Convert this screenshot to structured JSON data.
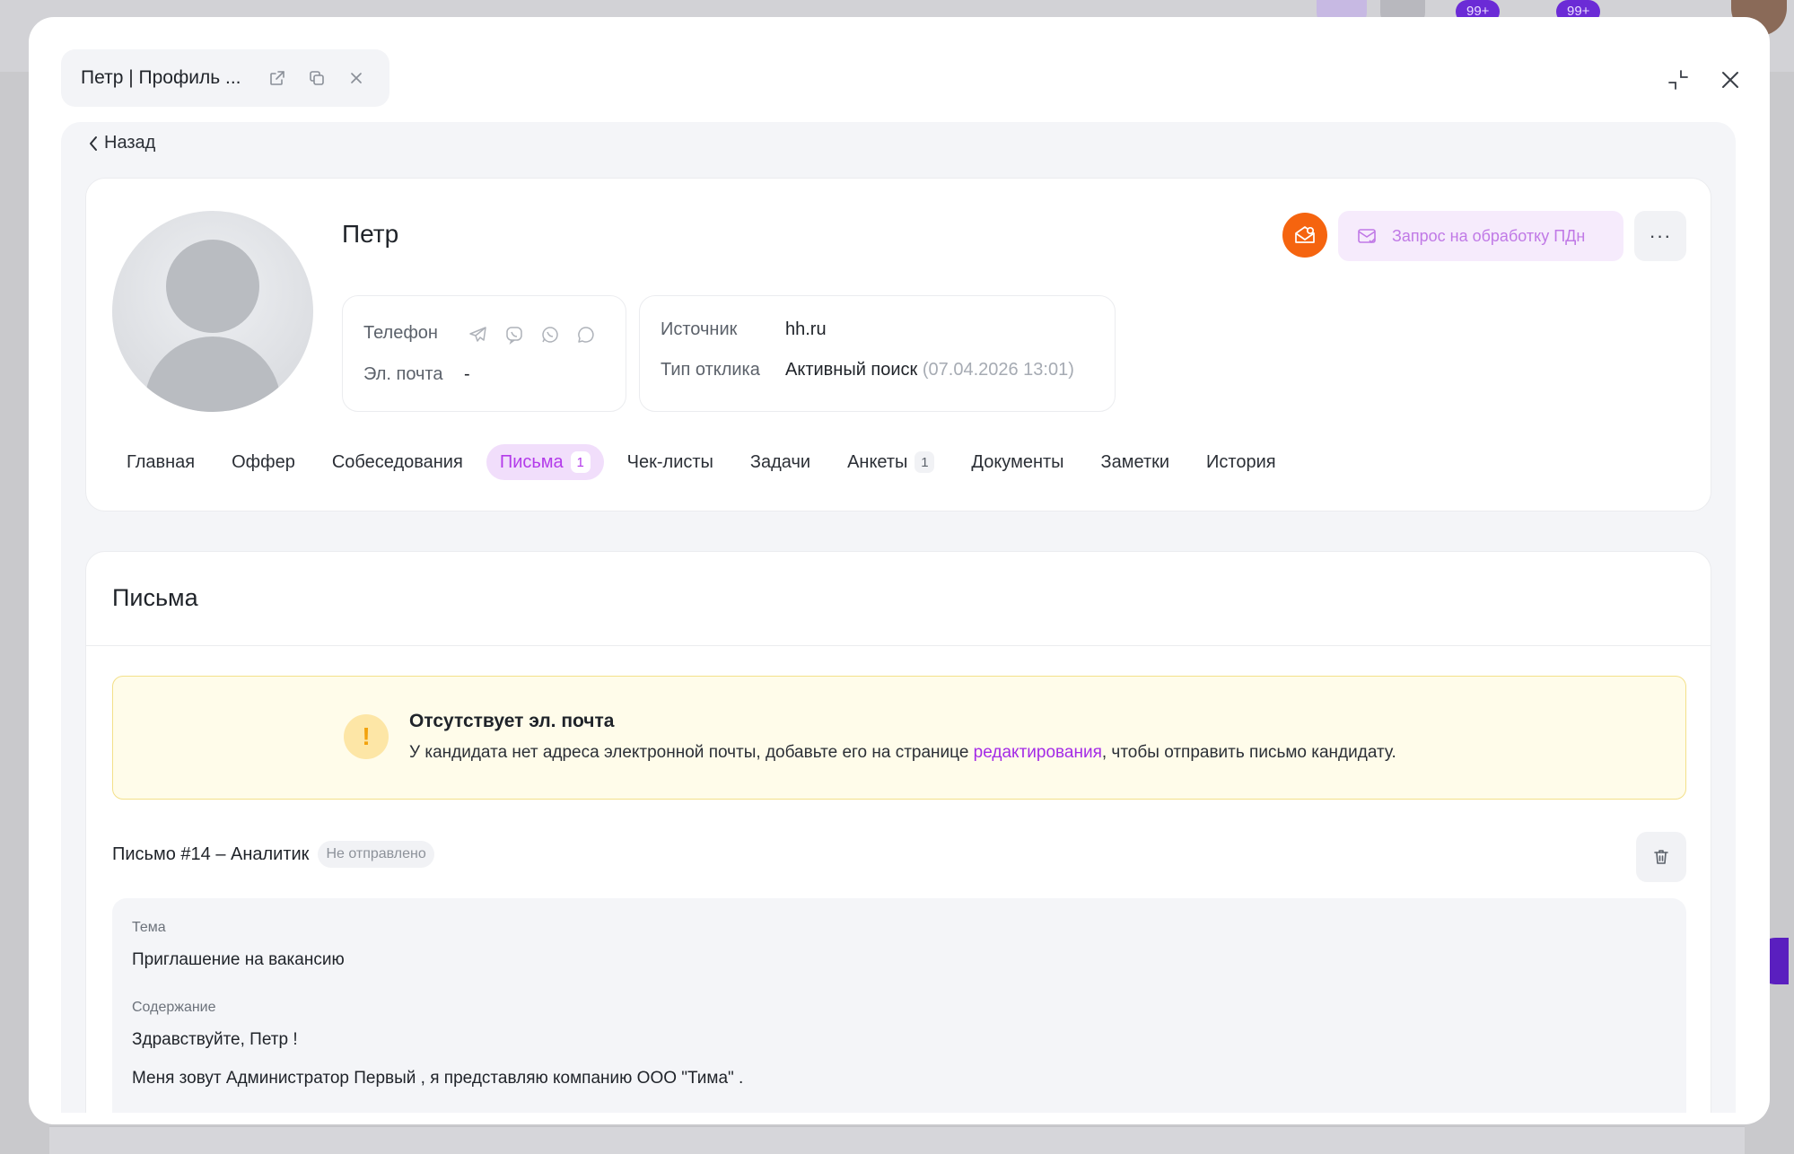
{
  "background": {
    "badges": [
      "99+",
      "99+"
    ]
  },
  "tab": {
    "title": "Петр | Профиль ...",
    "icons": [
      "external-link-icon",
      "copy-icon",
      "close-icon"
    ]
  },
  "window": {
    "minimize_icon": "collapse-icon",
    "close_icon": "close-icon"
  },
  "nav": {
    "back_label": "Назад"
  },
  "profile": {
    "name": "Петр",
    "phone_label": "Телефон",
    "email_label": "Эл. почта",
    "email_value": "-",
    "messengers": [
      "telegram-icon",
      "viber-icon",
      "whatsapp-icon",
      "chat-icon"
    ],
    "source_label": "Источник",
    "source_value": "hh.ru",
    "response_type_label": "Тип отклика",
    "response_type_value": "Активный поиск",
    "response_date": "(07.04.2026 13:01)",
    "pdn_button": "Запрос на обработку ПДн",
    "more_label": "···"
  },
  "tabs": [
    {
      "label": "Главная",
      "badge": ""
    },
    {
      "label": "Оффер",
      "badge": ""
    },
    {
      "label": "Собеседования",
      "badge": ""
    },
    {
      "label": "Письма",
      "badge": "1",
      "active": true
    },
    {
      "label": "Чек-листы",
      "badge": ""
    },
    {
      "label": "Задачи",
      "badge": ""
    },
    {
      "label": "Анкеты",
      "badge": "1"
    },
    {
      "label": "Документы",
      "badge": ""
    },
    {
      "label": "Заметки",
      "badge": ""
    },
    {
      "label": "История",
      "badge": ""
    }
  ],
  "letters": {
    "title": "Письма",
    "warning": {
      "title": "Отсутствует эл. почта",
      "text_before": "У кандидата нет адреса электронной почты, добавьте его на странице ",
      "link": "редактирования",
      "text_after": ", чтобы отправить письмо кандидату."
    },
    "letter": {
      "title": "Письмо #14 – Аналитик",
      "status": "Не отправлено",
      "subject_label": "Тема",
      "subject_value": "Приглашение на вакансию",
      "content_label": "Содержание",
      "content_lines": [
        "Здравствуйте, Петр !",
        "Меня зовут Администратор Первый , я представляю компанию ООО \"Тима\" ."
      ]
    }
  },
  "colors": {
    "accent": "#b33bea",
    "accent_bg": "#f1defb",
    "orange": "#f5640f",
    "warning_bg": "#fffcea",
    "warning_border": "#f3e08a"
  }
}
